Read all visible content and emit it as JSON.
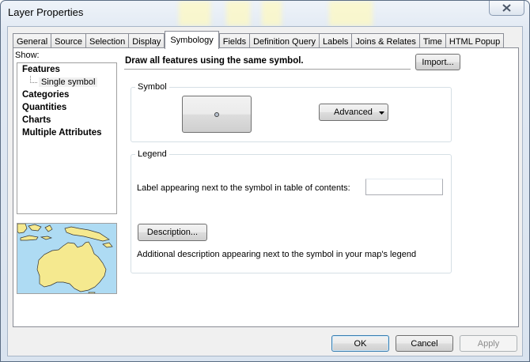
{
  "window": {
    "title": "Layer Properties"
  },
  "tabs": [
    {
      "label": "General"
    },
    {
      "label": "Source"
    },
    {
      "label": "Selection"
    },
    {
      "label": "Display"
    },
    {
      "label": "Symbology"
    },
    {
      "label": "Fields"
    },
    {
      "label": "Definition Query"
    },
    {
      "label": "Labels"
    },
    {
      "label": "Joins & Relates"
    },
    {
      "label": "Time"
    },
    {
      "label": "HTML Popup"
    }
  ],
  "show": {
    "label": "Show:",
    "items": {
      "features": "Features",
      "single_symbol": "Single symbol",
      "categories": "Categories",
      "quantities": "Quantities",
      "charts": "Charts",
      "multiple_attributes": "Multiple Attributes"
    }
  },
  "symbology": {
    "headline": "Draw all features using the same symbol.",
    "import_label": "Import...",
    "symbol_group_title": "Symbol",
    "advanced_label": "Advanced",
    "legend_group_title": "Legend",
    "legend_label_prompt": "Label appearing next to the symbol in table of contents:",
    "legend_label_value": "",
    "description_label": "Description...",
    "description_hint": "Additional description appearing next to the symbol in your map's legend"
  },
  "footer": {
    "ok_label": "OK",
    "cancel_label": "Cancel",
    "apply_label": "Apply"
  },
  "colors": {
    "sea": "#aedbf3",
    "land": "#f5e98f",
    "active_tab": "#ffffff"
  }
}
